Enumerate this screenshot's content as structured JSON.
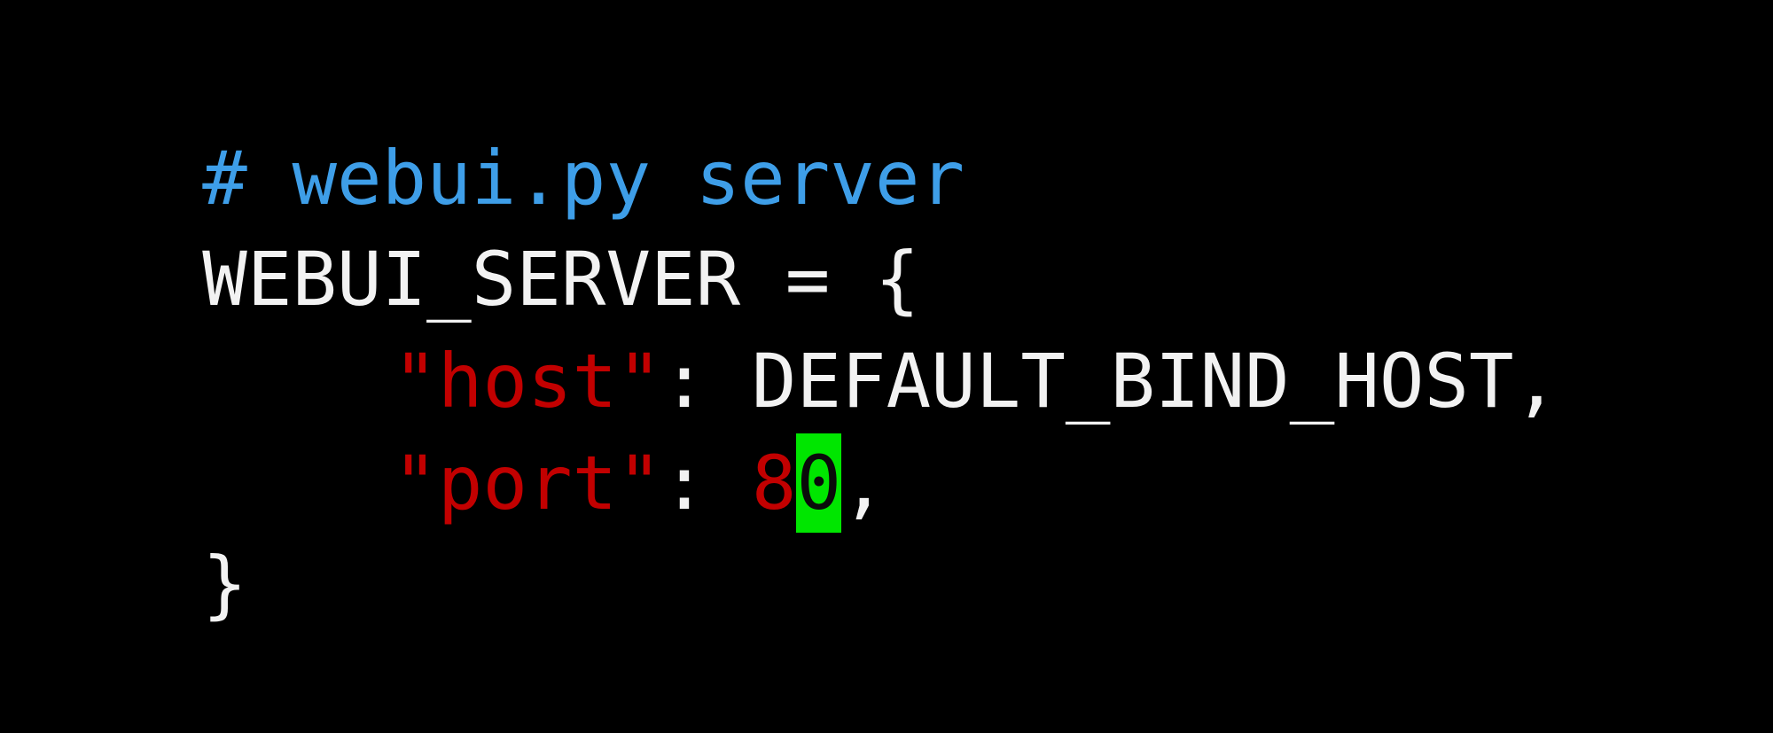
{
  "editor": {
    "colors": {
      "background": "#000000",
      "comment": "#3e9ee8",
      "text": "#f2f2f2",
      "string": "#c20000",
      "number": "#c20000",
      "cursor": "#00e600"
    },
    "lines": {
      "comment": "# webui.py server",
      "assign_name": "WEBUI_SERVER",
      "assign_op": " = {",
      "host_key": "\"host\"",
      "host_sep": ": ",
      "host_value": "DEFAULT_BIND_HOST",
      "host_comma": ",",
      "port_key": "\"port\"",
      "port_sep": ": ",
      "port_value_before_cursor": "8",
      "port_cursor_char": "0",
      "port_comma": ",",
      "close": "}"
    }
  }
}
